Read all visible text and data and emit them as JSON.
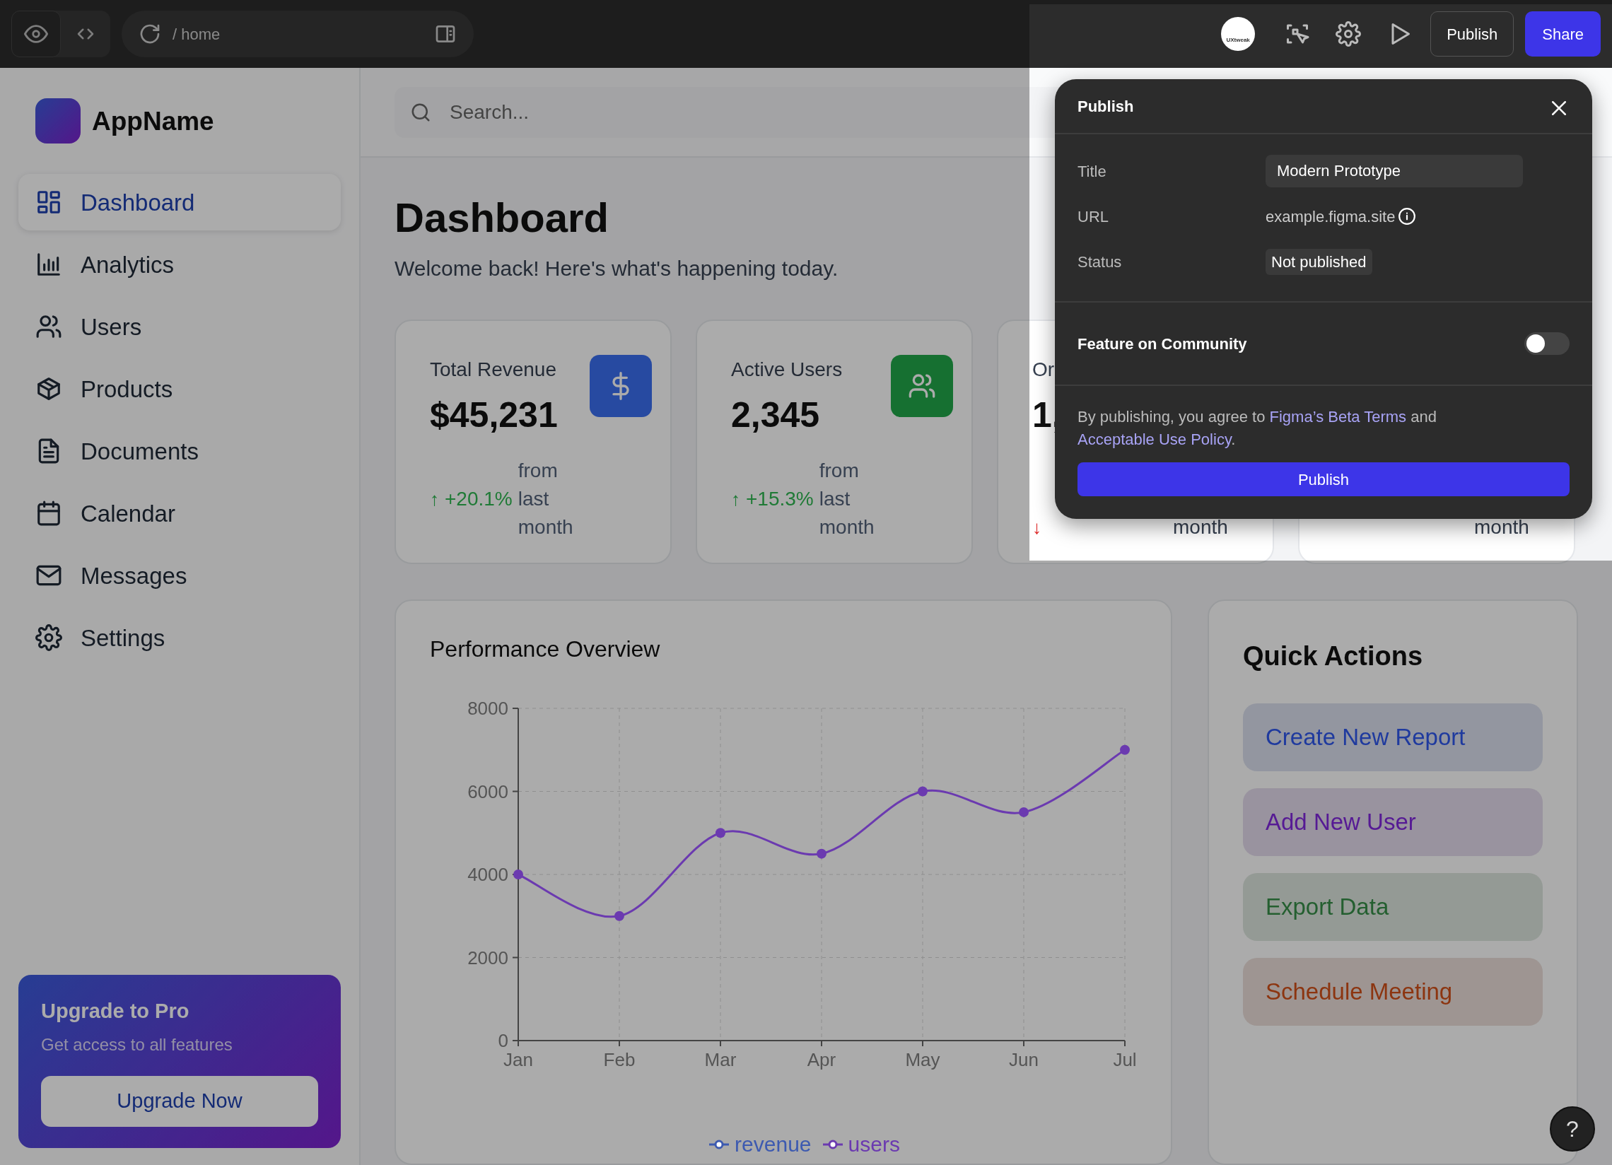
{
  "toolbar": {
    "path": "/ home",
    "logo_text": "UXtweak",
    "buttons": [
      {
        "label": "Publish",
        "kind": "outline"
      },
      {
        "label": "Share",
        "kind": "primary"
      }
    ]
  },
  "sidebar": {
    "app_name": "AppName",
    "items": [
      {
        "label": "Dashboard",
        "kind": "grid",
        "selected": true
      },
      {
        "label": "Analytics",
        "kind": "bars",
        "selected": false
      },
      {
        "label": "Users",
        "kind": "users",
        "selected": false
      },
      {
        "label": "Products",
        "kind": "box",
        "selected": false
      },
      {
        "label": "Documents",
        "kind": "doc",
        "selected": false
      },
      {
        "label": "Calendar",
        "kind": "calendar",
        "selected": false
      },
      {
        "label": "Messages",
        "kind": "mail",
        "selected": false
      },
      {
        "label": "Settings",
        "kind": "gear",
        "selected": false
      }
    ],
    "upgrade": {
      "title": "Upgrade to Pro",
      "text": "Get access to all features",
      "button": "Upgrade Now"
    }
  },
  "search": {
    "placeholder": "Search..."
  },
  "page": {
    "title": "Dashboard",
    "subtitle": "Welcome back! Here's what's happening today."
  },
  "stats": [
    {
      "title": "Total Revenue",
      "value": "$45,231",
      "arrow": "↑",
      "color": "#1f7a36",
      "change": "+20.1%",
      "note": "from last month",
      "kind": "dollar"
    },
    {
      "title": "Active Users",
      "value": "2,345",
      "arrow": "↑",
      "color": "#1f7a36",
      "change": "+15.3%",
      "note": "from last month",
      "kind": "users"
    },
    {
      "title": "Or",
      "value": "1,",
      "arrow": "↓",
      "color": "#dc2626",
      "note": "month"
    },
    {
      "note": "month"
    }
  ],
  "performance": {
    "title": "Performance Overview",
    "chart_data": {
      "type": "line",
      "categories": [
        "Jan",
        "Feb",
        "Mar",
        "Apr",
        "May",
        "Jun",
        "Jul"
      ],
      "ylim": [
        0,
        8000
      ],
      "grid": true,
      "yticks": [
        0,
        2000,
        4000,
        6000,
        8000
      ],
      "series": [
        {
          "name": "revenue",
          "color": "#3d5ab0",
          "values": [
            null,
            null,
            null,
            null,
            null,
            null,
            null
          ]
        },
        {
          "name": "users",
          "color": "#6b3ab0",
          "marker": "circle",
          "values": [
            4000,
            3000,
            5000,
            4500,
            6000,
            5500,
            7000
          ]
        }
      ]
    }
  },
  "quick_actions": {
    "title": "Quick Actions",
    "items": [
      {
        "label": "Create New Report",
        "color": "#1f3a9e"
      },
      {
        "label": "Add New User",
        "color": "#561a94"
      },
      {
        "label": "Export Data",
        "color": "#245f30"
      },
      {
        "label": "Schedule Meeting",
        "color": "#8c3510"
      }
    ]
  },
  "publish_dialog": {
    "title": "Publish",
    "fields": [
      {
        "label": "Title",
        "value": "Modern Prototype",
        "kind": "input"
      },
      {
        "label": "URL",
        "value": "example.figma.site",
        "kind": "link"
      },
      {
        "label": "Status",
        "value": "Not published",
        "kind": "badge"
      }
    ],
    "feature": {
      "label": "Feature on Community",
      "on": false
    },
    "terms": "By publishing, you agree to ",
    "terms_link1": "Figma’s Beta Terms",
    "terms_and": " and ",
    "terms_link2": "Acceptable Use Policy",
    "terms_end": ".",
    "button": "Publish"
  },
  "help": "?"
}
